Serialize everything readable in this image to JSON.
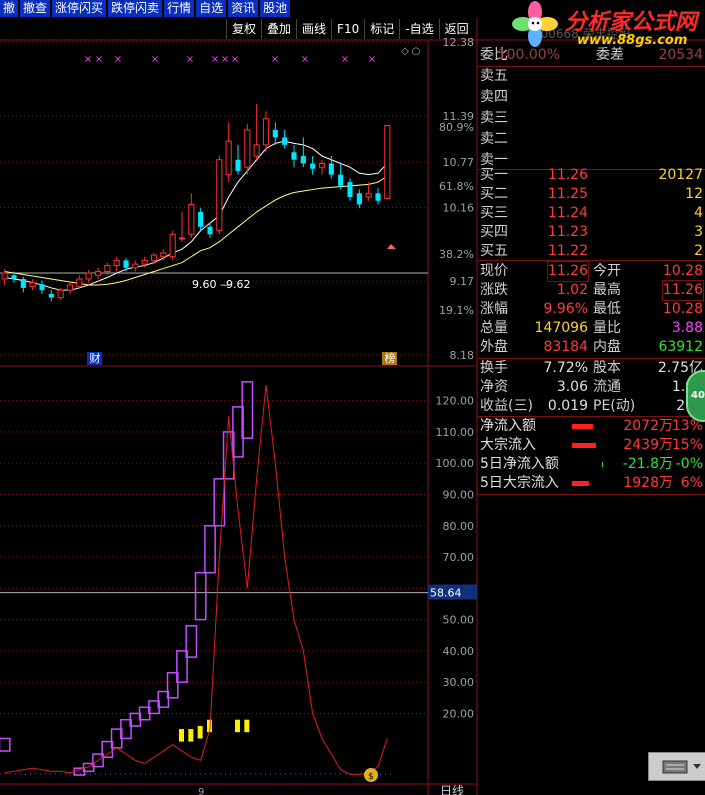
{
  "toolbar": [
    "撤",
    "撤查",
    "涨停闪买",
    "跌停闪卖",
    "行情",
    "自选",
    "资讯",
    "股池"
  ],
  "chart_toolbar": [
    "复权",
    "叠加",
    "画线",
    "F10",
    "标记",
    "-自选",
    "返回"
  ],
  "watermark": {
    "title": "分析家公式网",
    "url": "www.88gs.com"
  },
  "header_faded": "000668 荣丰控股",
  "upper_axis": {
    "prices": [
      "12.38",
      "11.39",
      "10.77",
      "10.16",
      "9.17",
      "8.18"
    ],
    "percents": [
      "80.9%",
      "61.8%",
      "38.2%",
      "19.1%"
    ]
  },
  "ma_labels": {
    "left": "9.60",
    "right": "9.62"
  },
  "markers": {
    "left": "财",
    "right": "榜"
  },
  "lower_axis": {
    "ticks": [
      "120.00",
      "110.00",
      "100.00",
      "90.00",
      "80.00",
      "70.00",
      "60.00",
      "50.00",
      "40.00",
      "30.00",
      "20.00"
    ],
    "current_value": "58.64"
  },
  "bottom": {
    "axis_tag": "9",
    "period": "日线"
  },
  "quote": {
    "wei": {
      "label": "委比",
      "value": "100.00%",
      "label2": "委差",
      "value2": "20534"
    },
    "sell": [
      {
        "label": "卖五"
      },
      {
        "label": "卖四"
      },
      {
        "label": "卖三"
      },
      {
        "label": "卖二"
      },
      {
        "label": "卖一"
      }
    ],
    "buy": [
      {
        "label": "买一",
        "price": "11.26",
        "vol": "20127"
      },
      {
        "label": "买二",
        "price": "11.25",
        "vol": "12"
      },
      {
        "label": "买三",
        "price": "11.24",
        "vol": "4"
      },
      {
        "label": "买四",
        "price": "11.23",
        "vol": "3"
      },
      {
        "label": "买五",
        "price": "11.22",
        "vol": "2"
      }
    ],
    "stats": [
      {
        "l1": "现价",
        "v1": "11.26",
        "l2": "今开",
        "v2": "10.28"
      },
      {
        "l1": "涨跌",
        "v1": "1.02",
        "l2": "最高",
        "v2": "11.26"
      },
      {
        "l1": "涨幅",
        "v1": "9.96%",
        "l2": "最低",
        "v2": "10.28"
      },
      {
        "l1": "总量",
        "v1": "147096",
        "l2": "量比",
        "v2": "3.88"
      },
      {
        "l1": "外盘",
        "v1": "83184",
        "l2": "内盘",
        "v2": "63912"
      }
    ],
    "stats2": [
      {
        "l1": "换手",
        "v1": "7.72%",
        "l2": "股本",
        "v2": "2.75亿"
      },
      {
        "l1": "净资",
        "v1": "3.06",
        "l2": "流通",
        "v2": "1.91"
      },
      {
        "l1": "收益(三)",
        "v1": "0.019",
        "l2": "PE(动)",
        "v2": "297"
      }
    ],
    "flows": [
      {
        "label": "净流入额",
        "amount": "2072万",
        "pct": "13%",
        "bar": 0.7
      },
      {
        "label": "大宗流入",
        "amount": "2439万",
        "pct": "15%",
        "bar": 0.8
      },
      {
        "label": "5日净流入额",
        "amount": "-21.8万",
        "pct": "-0%",
        "bar": 0.02
      },
      {
        "label": "5日大宗流入",
        "amount": "1928万",
        "pct": "6%",
        "bar": 0.55
      }
    ]
  },
  "badge": "40",
  "colors": {
    "up": "#ff3030",
    "down": "#00e5ff",
    "ma5": "#ffffff",
    "ma10": "#ffff80",
    "grid": "#8b1010",
    "indicator": "#e0201c",
    "box": "#c050ff",
    "quote_red": "#ff3a3a",
    "quote_green": "#3adf3a",
    "quote_yellow": "#ffd030"
  },
  "chart_data": {
    "type": "candlestick",
    "y_range_price": [
      8.18,
      12.38
    ],
    "candles": [
      {
        "o": 9.2,
        "c": 9.28,
        "h": 9.33,
        "l": 9.12
      },
      {
        "o": 9.25,
        "c": 9.2,
        "h": 9.3,
        "l": 9.15
      },
      {
        "o": 9.2,
        "c": 9.08,
        "h": 9.23,
        "l": 9.02
      },
      {
        "o": 9.1,
        "c": 9.15,
        "h": 9.2,
        "l": 9.05
      },
      {
        "o": 9.13,
        "c": 9.05,
        "h": 9.18,
        "l": 9.0
      },
      {
        "o": 9.0,
        "c": 8.95,
        "h": 9.05,
        "l": 8.9
      },
      {
        "o": 8.95,
        "c": 9.05,
        "h": 9.08,
        "l": 8.92
      },
      {
        "o": 9.05,
        "c": 9.12,
        "h": 9.15,
        "l": 9.0
      },
      {
        "o": 9.1,
        "c": 9.2,
        "h": 9.25,
        "l": 9.08
      },
      {
        "o": 9.2,
        "c": 9.28,
        "h": 9.32,
        "l": 9.15
      },
      {
        "o": 9.25,
        "c": 9.3,
        "h": 9.35,
        "l": 9.2
      },
      {
        "o": 9.3,
        "c": 9.38,
        "h": 9.42,
        "l": 9.25
      },
      {
        "o": 9.38,
        "c": 9.45,
        "h": 9.5,
        "l": 9.3
      },
      {
        "o": 9.45,
        "c": 9.35,
        "h": 9.48,
        "l": 9.3
      },
      {
        "o": 9.35,
        "c": 9.4,
        "h": 9.45,
        "l": 9.3
      },
      {
        "o": 9.4,
        "c": 9.45,
        "h": 9.5,
        "l": 9.35
      },
      {
        "o": 9.45,
        "c": 9.52,
        "h": 9.55,
        "l": 9.4
      },
      {
        "o": 9.5,
        "c": 9.55,
        "h": 9.6,
        "l": 9.45
      },
      {
        "o": 9.5,
        "c": 9.8,
        "h": 9.85,
        "l": 9.45
      },
      {
        "o": 9.75,
        "c": 9.75,
        "h": 10.1,
        "l": 9.7
      },
      {
        "o": 9.8,
        "c": 10.2,
        "h": 10.35,
        "l": 9.75
      },
      {
        "o": 10.1,
        "c": 9.9,
        "h": 10.15,
        "l": 9.85
      },
      {
        "o": 9.9,
        "c": 9.8,
        "h": 9.95,
        "l": 9.75
      },
      {
        "o": 9.85,
        "c": 10.8,
        "h": 10.85,
        "l": 9.8
      },
      {
        "o": 10.6,
        "c": 11.05,
        "h": 11.3,
        "l": 10.5
      },
      {
        "o": 10.8,
        "c": 10.65,
        "h": 11.0,
        "l": 10.6
      },
      {
        "o": 10.7,
        "c": 11.2,
        "h": 11.28,
        "l": 10.6
      },
      {
        "o": 10.85,
        "c": 11.0,
        "h": 11.55,
        "l": 10.8
      },
      {
        "o": 11.0,
        "c": 11.35,
        "h": 11.45,
        "l": 10.9
      },
      {
        "o": 11.2,
        "c": 11.1,
        "h": 11.3,
        "l": 11.0
      },
      {
        "o": 11.1,
        "c": 11.0,
        "h": 11.2,
        "l": 10.95
      },
      {
        "o": 10.9,
        "c": 10.8,
        "h": 11.0,
        "l": 10.7
      },
      {
        "o": 10.85,
        "c": 10.75,
        "h": 11.1,
        "l": 10.7
      },
      {
        "o": 10.75,
        "c": 10.68,
        "h": 10.85,
        "l": 10.6
      },
      {
        "o": 10.7,
        "c": 10.75,
        "h": 10.8,
        "l": 10.6
      },
      {
        "o": 10.75,
        "c": 10.6,
        "h": 10.85,
        "l": 10.55
      },
      {
        "o": 10.6,
        "c": 10.45,
        "h": 10.75,
        "l": 10.4
      },
      {
        "o": 10.5,
        "c": 10.3,
        "h": 10.55,
        "l": 10.25
      },
      {
        "o": 10.35,
        "c": 10.2,
        "h": 10.4,
        "l": 10.15
      },
      {
        "o": 10.3,
        "c": 10.35,
        "h": 10.5,
        "l": 10.25
      },
      {
        "o": 10.35,
        "c": 10.25,
        "h": 10.42,
        "l": 10.2
      },
      {
        "o": 10.28,
        "c": 11.26,
        "h": 11.26,
        "l": 10.28
      }
    ],
    "ma5": [
      9.22,
      9.2,
      9.18,
      9.15,
      9.12,
      9.08,
      9.05,
      9.05,
      9.08,
      9.12,
      9.17,
      9.22,
      9.28,
      9.33,
      9.36,
      9.38,
      9.42,
      9.48,
      9.55,
      9.6,
      9.7,
      9.85,
      9.95,
      10.05,
      10.3,
      10.5,
      10.65,
      10.8,
      10.95,
      11.02,
      11.05,
      11.02,
      11.0,
      10.95,
      10.85,
      10.8,
      10.75,
      10.7,
      10.62,
      10.6,
      10.62,
      10.75
    ],
    "ma10": [
      9.3,
      9.28,
      9.26,
      9.24,
      9.22,
      9.2,
      9.18,
      9.16,
      9.14,
      9.12,
      9.12,
      9.13,
      9.15,
      9.18,
      9.22,
      9.26,
      9.3,
      9.34,
      9.38,
      9.42,
      9.5,
      9.58,
      9.62,
      9.7,
      9.8,
      9.9,
      10.0,
      10.1,
      10.18,
      10.26,
      10.32,
      10.36,
      10.38,
      10.4,
      10.42,
      10.43,
      10.44,
      10.45,
      10.46,
      10.47,
      10.5,
      10.58
    ],
    "indicator_range": [
      0,
      125
    ],
    "indicator_line": [
      1,
      1.5,
      2,
      2.5,
      2,
      1.5,
      1.5,
      1,
      2,
      3,
      5,
      7,
      9,
      7,
      5,
      4,
      6,
      8,
      10,
      8,
      6,
      5,
      15,
      70,
      115,
      85,
      60,
      95,
      125,
      100,
      70,
      50,
      40,
      20,
      12,
      7,
      2,
      0.5,
      0.5,
      1,
      3,
      12
    ],
    "indicator_boxes": [
      [
        0,
        8,
        12
      ],
      [
        8,
        0.3,
        2.5
      ],
      [
        9,
        1.5,
        4
      ],
      [
        10,
        3,
        7
      ],
      [
        11,
        6,
        11
      ],
      [
        12,
        9,
        15
      ],
      [
        13,
        12,
        18
      ],
      [
        14,
        16,
        20
      ],
      [
        15,
        18,
        22
      ],
      [
        16,
        20,
        24
      ],
      [
        17,
        22,
        27
      ],
      [
        18,
        25,
        33
      ],
      [
        19,
        30,
        40
      ],
      [
        20,
        38,
        48
      ],
      [
        21,
        50,
        65
      ],
      [
        22,
        65,
        80
      ],
      [
        23,
        80,
        95
      ],
      [
        24,
        95,
        110
      ],
      [
        25,
        102,
        118
      ],
      [
        26,
        108,
        126
      ]
    ],
    "yellow_bars": [
      [
        19,
        15
      ],
      [
        20,
        15
      ],
      [
        21,
        16
      ],
      [
        22,
        18
      ],
      [
        25,
        18
      ],
      [
        26,
        18
      ]
    ],
    "current_value": 58.64
  }
}
